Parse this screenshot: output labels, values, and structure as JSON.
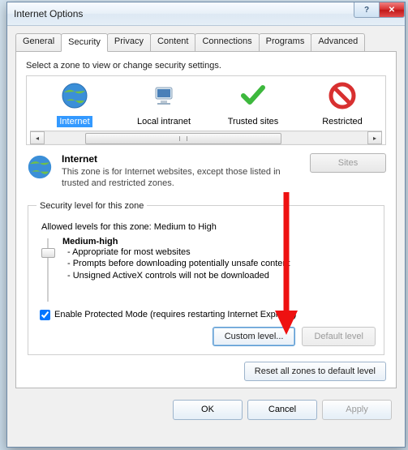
{
  "window": {
    "title": "Internet Options"
  },
  "tabs": {
    "t0": "General",
    "t1": "Security",
    "t2": "Privacy",
    "t3": "Content",
    "t4": "Connections",
    "t5": "Programs",
    "t6": "Advanced"
  },
  "zone": {
    "instruction": "Select a zone to view or change security settings.",
    "items": {
      "z0": "Internet",
      "z1": "Local intranet",
      "z2": "Trusted sites",
      "z3": "Restricted"
    },
    "selected_title": "Internet",
    "selected_desc": "This zone is for Internet websites, except those listed in trusted and restricted zones.",
    "sites_label": "Sites"
  },
  "security": {
    "legend": "Security level for this zone",
    "allowed": "Allowed levels for this zone: Medium to High",
    "level_name": "Medium-high",
    "b1": "- Appropriate for most websites",
    "b2": "- Prompts before downloading potentially unsafe content",
    "b3": "- Unsigned ActiveX controls will not be downloaded",
    "protected": "Enable Protected Mode (requires restarting Internet Explorer)",
    "custom": "Custom level...",
    "default": "Default level",
    "reset": "Reset all zones to default level"
  },
  "dialog": {
    "ok": "OK",
    "cancel": "Cancel",
    "apply": "Apply"
  }
}
